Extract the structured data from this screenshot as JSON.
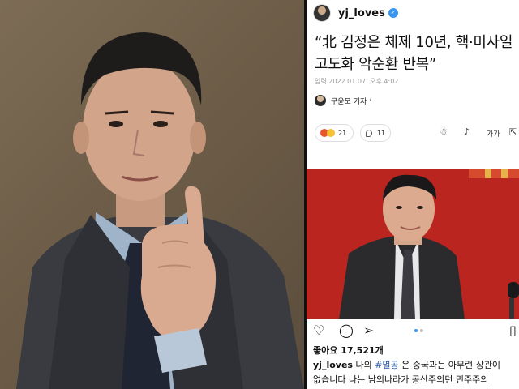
{
  "instagram": {
    "username": "yj_loves",
    "headline_line1": "“北 김정은 체제 10년, 핵·미사일",
    "headline_line2": "고도화 악순환 반복”",
    "date": "입력 2022.01.07. 오후 4:02",
    "author": "구윤모 기자",
    "reaction_count": "21",
    "comment_count": "11",
    "likes": "좋아요 17,521개",
    "caption_user": "yj_loves",
    "caption_pre": " 나의 ",
    "caption_tag": "#멸공",
    "caption_post": " 은 중국과는 아무런 상관이",
    "caption_line2": "없습니다 나는 남의나라가 공산주의던 민주주의"
  },
  "icons": [
    "verified-icon",
    "chevron-right-icon",
    "angry-emoji",
    "laugh-emoji",
    "comment-icon",
    "robot-voice-icon",
    "speaker-icon",
    "font-size-icon",
    "share-icon",
    "heart-icon",
    "comment-bubble-icon",
    "send-icon",
    "bookmark-icon"
  ],
  "colors": {
    "accent_blue": "#3897f0",
    "hashtag": "#2b5aa8",
    "red_background": "#b8241f"
  }
}
